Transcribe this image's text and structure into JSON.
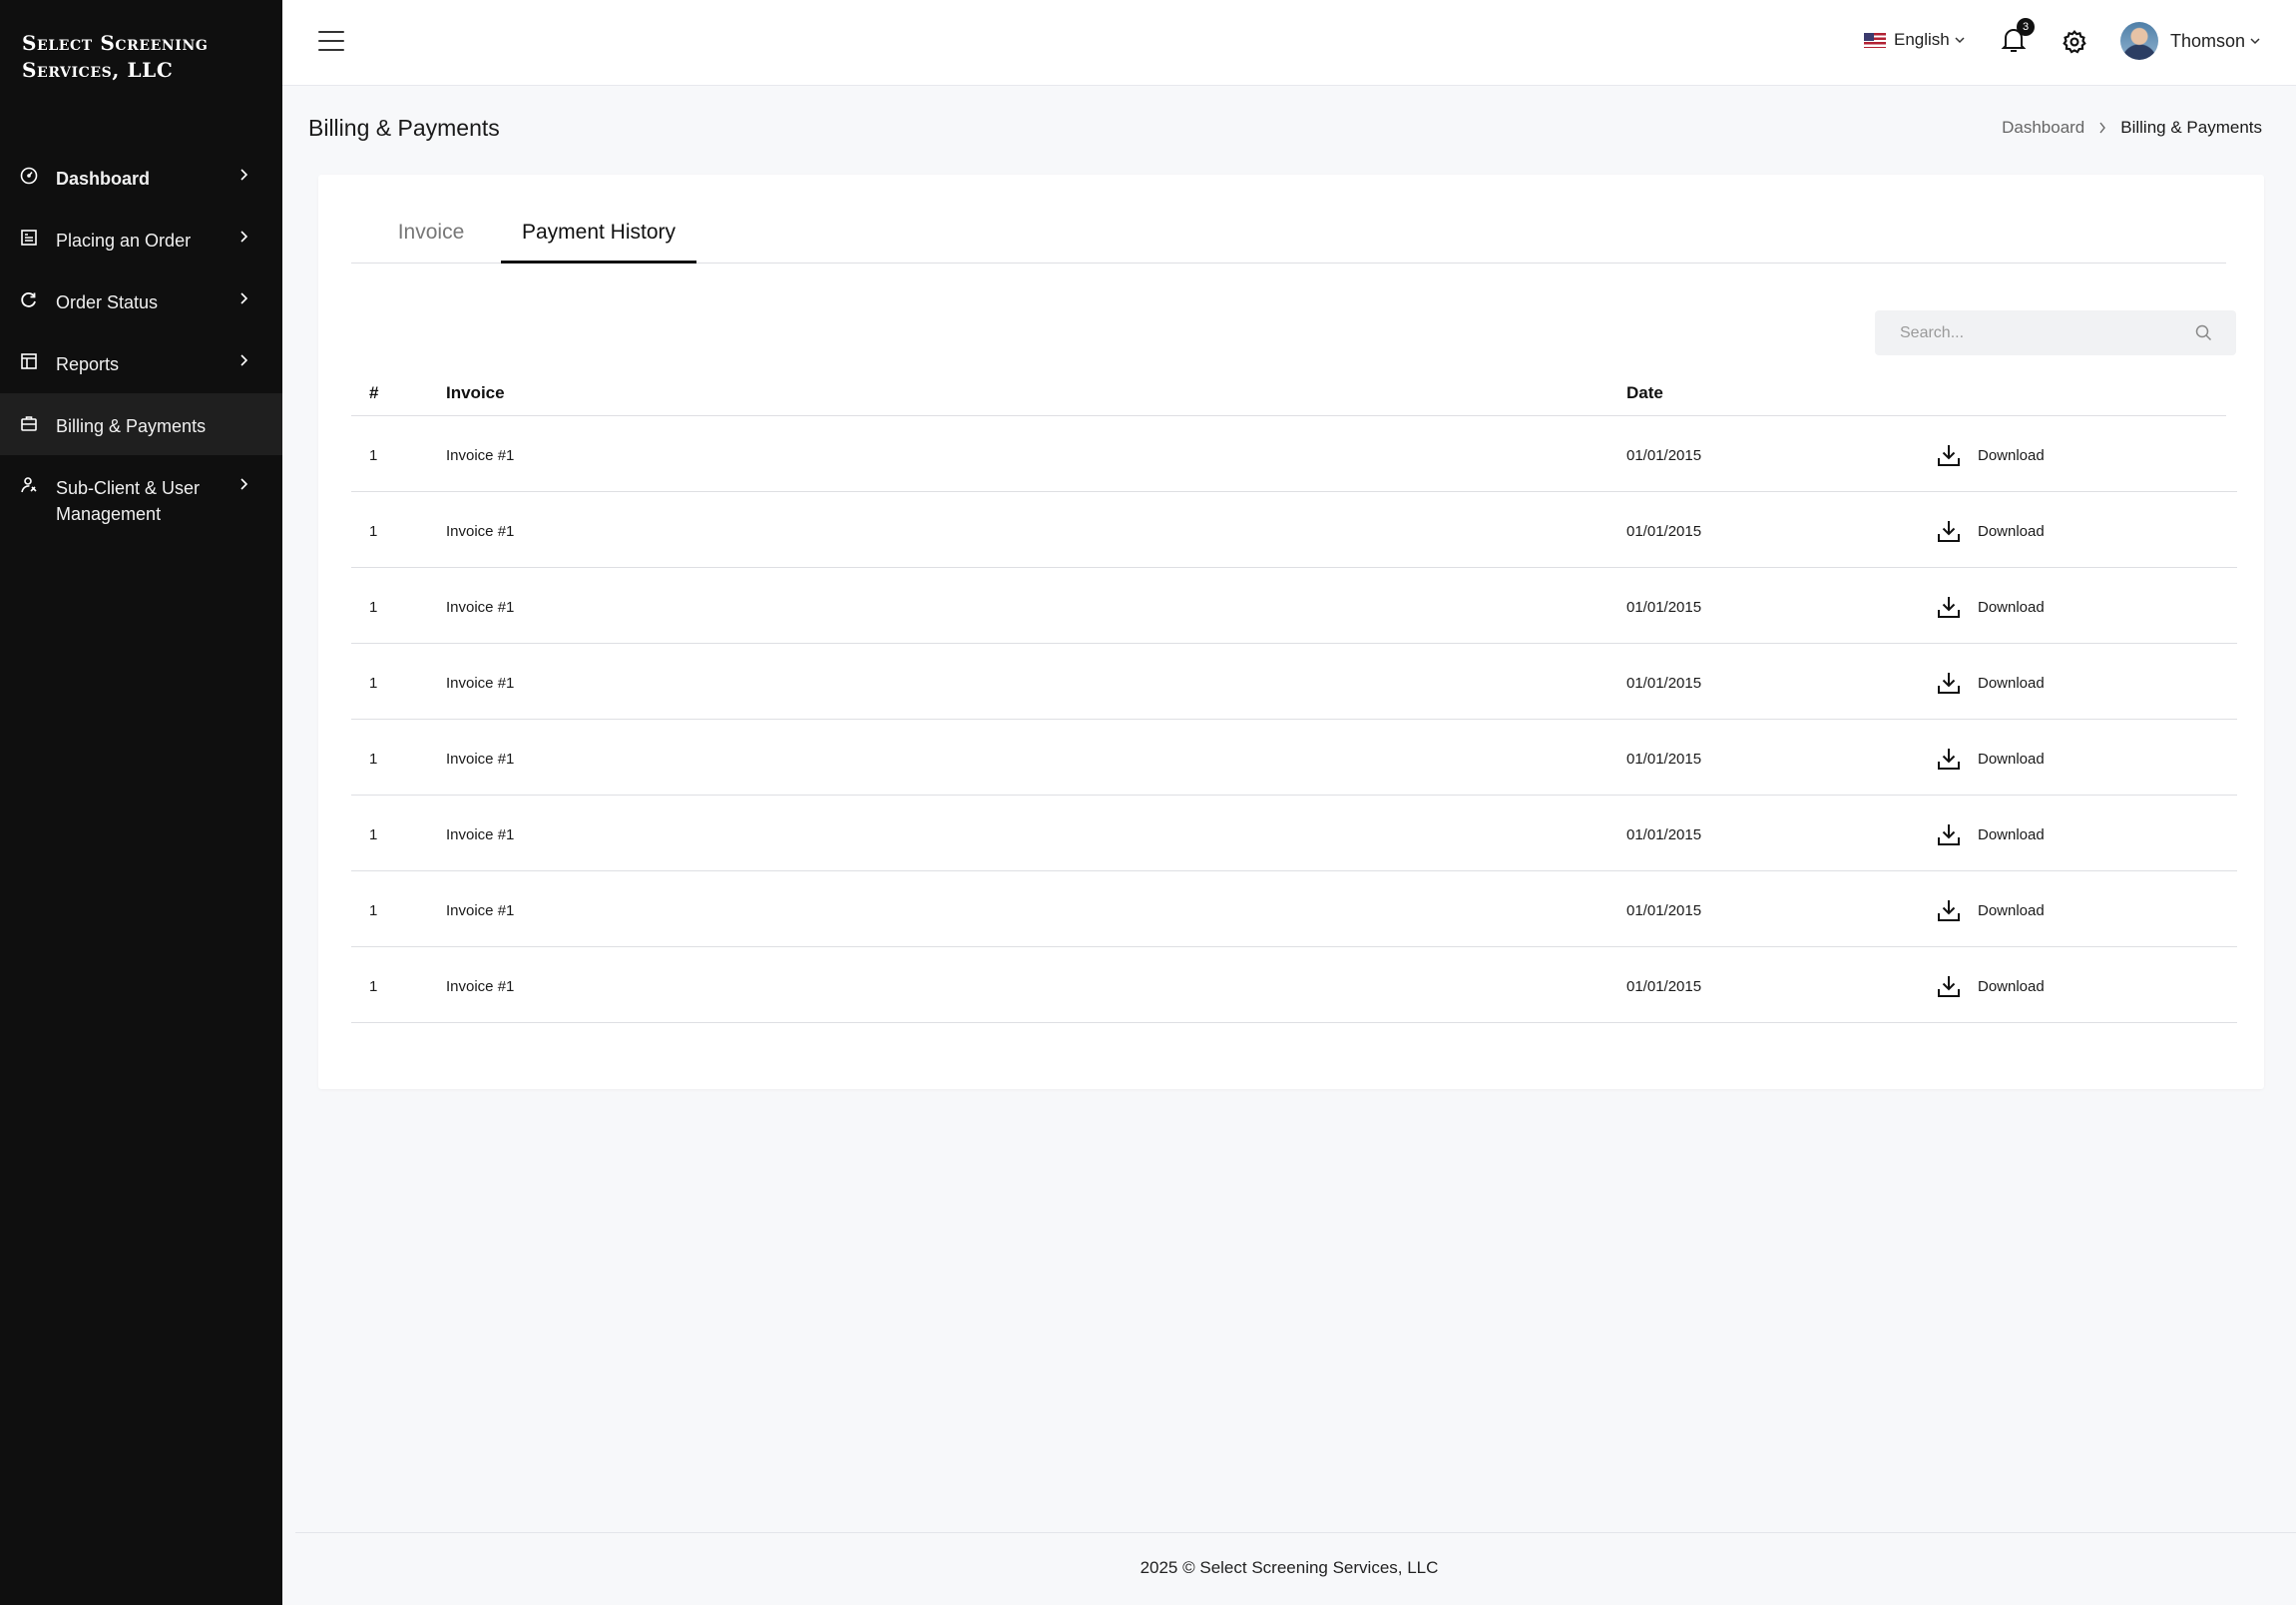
{
  "brand": {
    "name": "Select Screening Services, LLC"
  },
  "sidebar": {
    "items": [
      {
        "label": "Dashboard",
        "icon": "dashboard-icon"
      },
      {
        "label": "Placing an Order",
        "icon": "order-form-icon"
      },
      {
        "label": "Order Status",
        "icon": "refresh-icon"
      },
      {
        "label": "Reports",
        "icon": "reports-icon"
      },
      {
        "label": "Billing & Payments",
        "icon": "briefcase-icon",
        "active": true
      },
      {
        "label": "Sub-Client & User Management",
        "icon": "user-management-icon"
      }
    ]
  },
  "header": {
    "language": "English",
    "notification_count": "3",
    "user_name": "Thomson"
  },
  "page": {
    "title": "Billing & Payments",
    "breadcrumb": [
      "Dashboard",
      "Billing & Payments"
    ]
  },
  "tabs": [
    {
      "label": "Invoice",
      "active": false
    },
    {
      "label": "Payment History",
      "active": true
    }
  ],
  "search": {
    "placeholder": "Search..."
  },
  "table": {
    "columns": [
      "#",
      "Invoice",
      "Date"
    ],
    "rows": [
      {
        "num": "1",
        "invoice": "Invoice #1",
        "date": "01/01/2015",
        "action": "Download"
      },
      {
        "num": "1",
        "invoice": "Invoice #1",
        "date": "01/01/2015",
        "action": "Download"
      },
      {
        "num": "1",
        "invoice": "Invoice #1",
        "date": "01/01/2015",
        "action": "Download"
      },
      {
        "num": "1",
        "invoice": "Invoice #1",
        "date": "01/01/2015",
        "action": "Download"
      },
      {
        "num": "1",
        "invoice": "Invoice #1",
        "date": "01/01/2015",
        "action": "Download"
      },
      {
        "num": "1",
        "invoice": "Invoice #1",
        "date": "01/01/2015",
        "action": "Download"
      },
      {
        "num": "1",
        "invoice": "Invoice #1",
        "date": "01/01/2015",
        "action": "Download"
      },
      {
        "num": "1",
        "invoice": "Invoice #1",
        "date": "01/01/2015",
        "action": "Download"
      }
    ]
  },
  "footer": {
    "text": "2025 © Select Screening Services, LLC"
  },
  "colors": {
    "sidebar_bg": "#0f0f0f",
    "active_item_bg": "#1f1f1f",
    "page_bg": "#f7f8fa",
    "accent": "#111111"
  }
}
